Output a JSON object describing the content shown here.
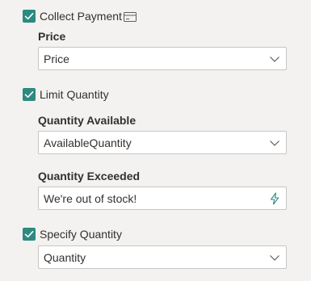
{
  "collect_payment": {
    "label": "Collect Payment",
    "checked": true,
    "icon": "card-icon"
  },
  "price": {
    "label": "Price",
    "value": "Price",
    "icon": "chevron-down-icon"
  },
  "limit_quantity": {
    "label": "Limit Quantity",
    "checked": true
  },
  "quantity_available": {
    "label": "Quantity Available",
    "value": "AvailableQuantity",
    "icon": "chevron-down-icon"
  },
  "quantity_exceeded": {
    "label": "Quantity Exceeded",
    "value": "We're out of stock!",
    "icon": "lightning-icon"
  },
  "specify_quantity": {
    "label": "Specify Quantity",
    "checked": true,
    "value": "Quantity",
    "icon": "chevron-down-icon"
  },
  "colors": {
    "accent": "#2d8a80",
    "background": "#f3f2f1",
    "field_border": "#c8c6c4"
  }
}
